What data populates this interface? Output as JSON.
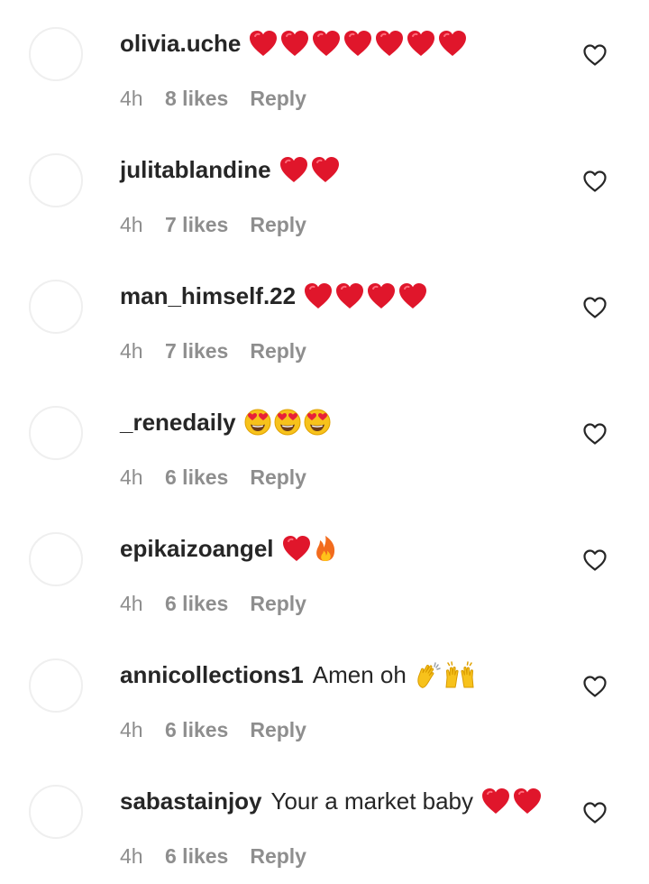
{
  "comments": [
    {
      "username": "olivia.uche",
      "text": "",
      "emojis": [
        "red-heart",
        "red-heart",
        "red-heart",
        "red-heart",
        "red-heart",
        "red-heart",
        "red-heart"
      ],
      "time": "4h",
      "likes": "8 likes",
      "reply": "Reply"
    },
    {
      "username": "julitablandine",
      "text": "",
      "emojis": [
        "red-heart",
        "red-heart"
      ],
      "time": "4h",
      "likes": "7 likes",
      "reply": "Reply"
    },
    {
      "username": "man_himself.22",
      "text": "",
      "emojis": [
        "red-heart",
        "red-heart",
        "red-heart",
        "red-heart"
      ],
      "time": "4h",
      "likes": "7 likes",
      "reply": "Reply"
    },
    {
      "username": "_renedaily",
      "text": "",
      "emojis": [
        "heart-eyes",
        "heart-eyes",
        "heart-eyes"
      ],
      "time": "4h",
      "likes": "6 likes",
      "reply": "Reply"
    },
    {
      "username": "epikaizoangel",
      "text": "",
      "emojis": [
        "red-heart",
        "fire"
      ],
      "time": "4h",
      "likes": "6 likes",
      "reply": "Reply"
    },
    {
      "username": "annicollections1",
      "text": "Amen oh",
      "emojis": [
        "clapping-hands",
        "raising-hands"
      ],
      "time": "4h",
      "likes": "6 likes",
      "reply": "Reply"
    },
    {
      "username": "sabastainjoy",
      "text": "Your a market baby",
      "emojis": [
        "red-heart",
        "red-heart"
      ],
      "time": "4h",
      "likes": "6 likes",
      "reply": "Reply"
    }
  ],
  "icons": {
    "like": "heart-outline-icon",
    "avatar": "avatar-placeholder"
  },
  "colors": {
    "text": "#262626",
    "meta": "#8e8e8e",
    "heart_emoji": "#e0162b",
    "avatar_border": "#efefef"
  }
}
